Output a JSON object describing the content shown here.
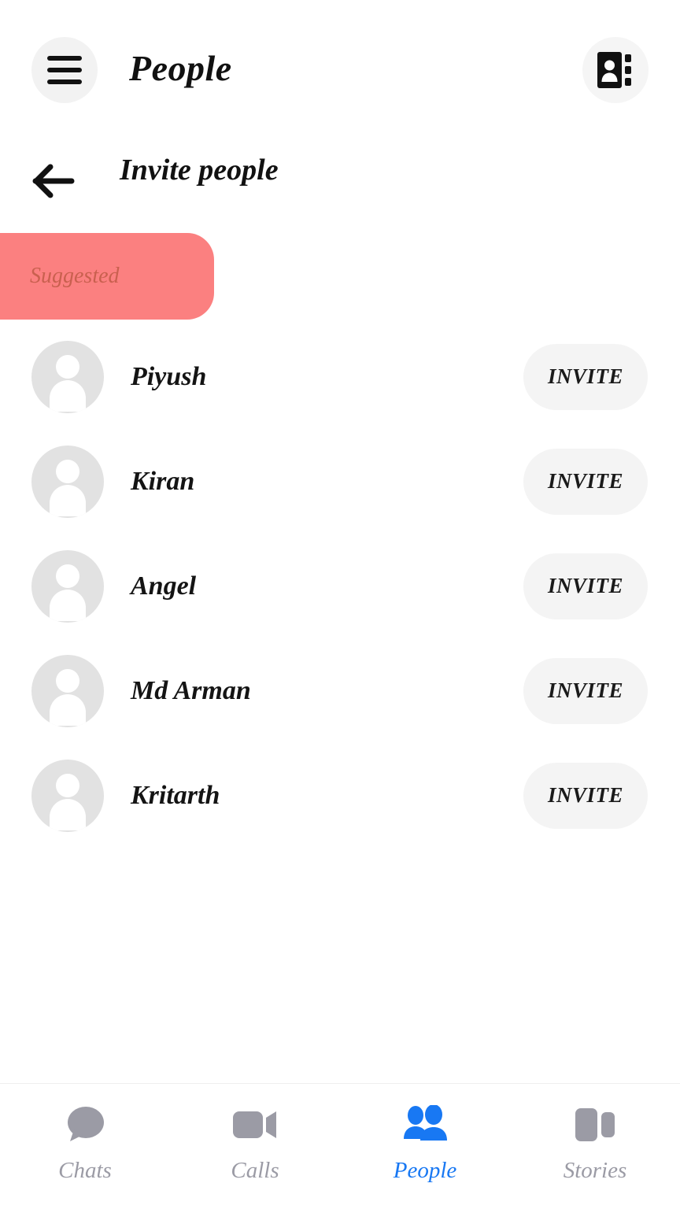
{
  "appbar": {
    "menu_icon": "hamburger-menu-icon",
    "title": "People",
    "contacts_icon": "address-book-icon"
  },
  "subheader": {
    "back_icon": "arrow-left-icon",
    "title": "Invite people"
  },
  "filter": {
    "chip_label": "Suggested",
    "chip_color": "#FB8080",
    "chip_text_color": "#c9604f"
  },
  "people": [
    {
      "name": "Piyush",
      "avatar_icon": "person-avatar-icon",
      "action_label": "INVITE"
    },
    {
      "name": "Kiran",
      "avatar_icon": "person-avatar-icon",
      "action_label": "INVITE"
    },
    {
      "name": "Angel",
      "avatar_icon": "person-avatar-icon",
      "action_label": "INVITE"
    },
    {
      "name": "Md Arman",
      "avatar_icon": "person-avatar-icon",
      "action_label": "INVITE"
    },
    {
      "name": "Kritarth",
      "avatar_icon": "person-avatar-icon",
      "action_label": "INVITE"
    }
  ],
  "bottom_nav": {
    "active_color": "#1878f3",
    "inactive_color": "#9b9ba5",
    "items": [
      {
        "label": "Chats",
        "icon": "chat-bubble-icon",
        "active": false
      },
      {
        "label": "Calls",
        "icon": "video-camera-icon",
        "active": false
      },
      {
        "label": "People",
        "icon": "people-icon",
        "active": true
      },
      {
        "label": "Stories",
        "icon": "stories-icon",
        "active": false
      }
    ]
  }
}
